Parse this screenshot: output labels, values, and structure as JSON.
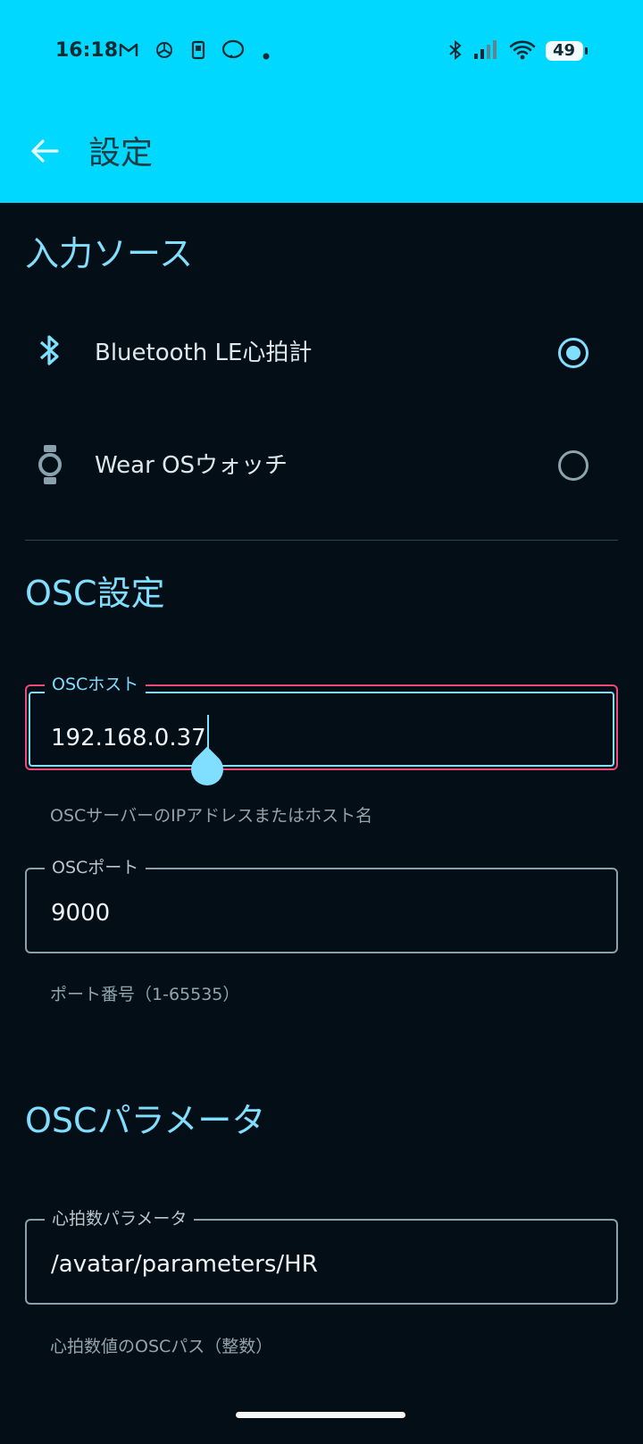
{
  "status_bar": {
    "time": "16:18",
    "notification_icons": [
      "gmail-icon",
      "chatgpt-icon",
      "flashcards-app-icon",
      "line-icon",
      "more-dot-icon"
    ],
    "system_icons": [
      "bluetooth-icon",
      "cell-signal-icon",
      "wifi-icon",
      "battery-icon"
    ],
    "battery": "49"
  },
  "app_bar": {
    "title": "設定",
    "back_icon": "arrow-back-icon",
    "color": "#00d8ff"
  },
  "input_source": {
    "title": "入力ソース",
    "options": [
      {
        "label": "Bluetooth LE心拍計",
        "icon": "bluetooth-icon",
        "selected": true
      },
      {
        "label": "Wear OSウォッチ",
        "icon": "watch-icon",
        "selected": false
      }
    ]
  },
  "osc_settings": {
    "title": "OSC設定",
    "host": {
      "label": "OSCホスト",
      "value": "192.168.0.37",
      "helper": "OSCサーバーのIPアドレスまたはホスト名",
      "focused": true
    },
    "port": {
      "label": "OSCポート",
      "value": "9000",
      "helper": "ポート番号（1-65535）"
    }
  },
  "osc_parameters": {
    "title": "OSCパラメータ",
    "heart_rate": {
      "label": "心拍数パラメータ",
      "value": "/avatar/parameters/HR",
      "helper": "心拍数値のOSCパス（整数）"
    }
  },
  "colors": {
    "accent": "#80deff",
    "background": "#030e17",
    "error_outline": "#ec4a78"
  }
}
